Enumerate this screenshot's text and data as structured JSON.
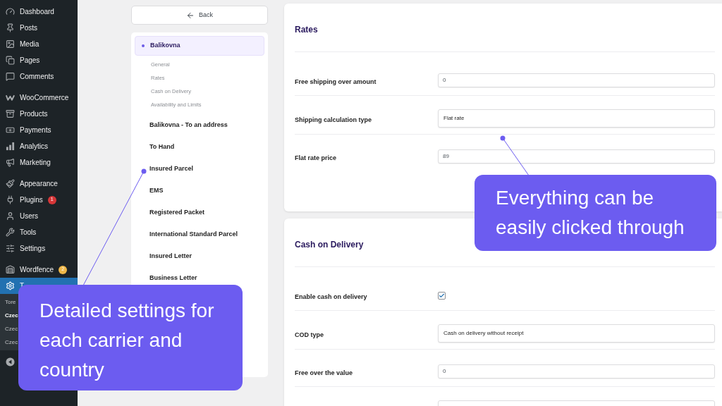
{
  "sidebar": {
    "groups": [
      [
        {
          "label": "Dashboard",
          "selected": false
        },
        {
          "label": "Posts",
          "selected": false
        },
        {
          "label": "Media",
          "selected": false
        },
        {
          "label": "Pages",
          "selected": false
        },
        {
          "label": "Comments",
          "selected": false
        }
      ],
      [
        {
          "label": "WooCommerce",
          "selected": false
        },
        {
          "label": "Products",
          "selected": false
        },
        {
          "label": "Payments",
          "selected": false
        },
        {
          "label": "Analytics",
          "selected": false
        },
        {
          "label": "Marketing",
          "selected": false
        }
      ],
      [
        {
          "label": "Appearance",
          "selected": false
        },
        {
          "label": "Plugins",
          "selected": false,
          "badge": {
            "text": "1",
            "color": "#d63638"
          }
        },
        {
          "label": "Users",
          "selected": false
        },
        {
          "label": "Tools",
          "selected": false
        },
        {
          "label": "Settings",
          "selected": false
        }
      ],
      [
        {
          "label": "Wordfence",
          "selected": false,
          "badge": {
            "text": "2",
            "color": "#f0b849"
          }
        },
        {
          "label": "T",
          "selected": true,
          "children": [
            {
              "label": "Tore",
              "selected": false
            },
            {
              "label": "Czec",
              "selected": true
            },
            {
              "label": "Czec",
              "selected": false
            },
            {
              "label": "Czec",
              "selected": false
            }
          ]
        }
      ]
    ]
  },
  "back_button": {
    "label": "Back"
  },
  "carriers": [
    {
      "label": "Balikovna",
      "selected": true,
      "children": [
        "General",
        "Rates",
        "Cash on Delivery",
        "Availability and Limits"
      ]
    },
    {
      "label": "Balikovna - To an address",
      "selected": false
    },
    {
      "label": "To Hand",
      "selected": false
    },
    {
      "label": "Insured Parcel",
      "selected": false
    },
    {
      "label": "EMS",
      "selected": false
    },
    {
      "label": "Registered Packet",
      "selected": false
    },
    {
      "label": "International Standard Parcel",
      "selected": false
    },
    {
      "label": "Insured Letter",
      "selected": false
    },
    {
      "label": "Business Letter",
      "selected": false
    }
  ],
  "sections": [
    {
      "title": "Rates",
      "rows": [
        {
          "kind": "input",
          "label": "Free shipping over amount",
          "value": "0"
        },
        {
          "kind": "select",
          "label": "Shipping calculation type",
          "value": "Flat rate"
        },
        {
          "kind": "input",
          "label": "Flat rate price",
          "value": "89"
        }
      ]
    },
    {
      "title": "Cash on Delivery",
      "rows": [
        {
          "kind": "checkbox",
          "label": "Enable cash on delivery",
          "checked": true
        },
        {
          "kind": "select",
          "label": "COD type",
          "value": "Cash on delivery without receipt"
        },
        {
          "kind": "input",
          "label": "Free over the value",
          "value": "0"
        },
        {
          "kind": "input"
        }
      ]
    }
  ],
  "callouts": [
    {
      "text": "Detailed settings for each carrier and country"
    },
    {
      "text": "Everything can be easily clicked through"
    }
  ]
}
